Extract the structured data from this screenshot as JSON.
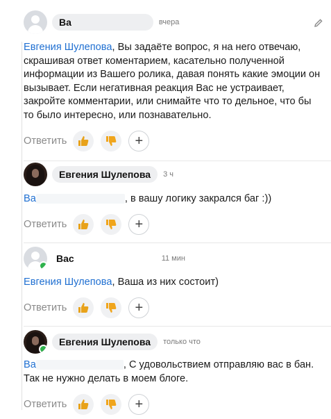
{
  "reply_label": "Ответить",
  "colors": {
    "mention": "#1f6fd1",
    "online": "#2fb24c",
    "like": "#e8a21a",
    "dislike": "#f0a51c"
  },
  "comments": [
    {
      "author": "Ва",
      "time": "вчера",
      "mention": "Евгения Шулепова",
      "text": ", Вы задаёте вопрос, я на него отвечаю, скрашивая ответ коментарием, касательно полученной информации из Вашего ролика, давая понять какие эмоции он вызывает. Если негативная реакция Вас не устраивает, закройте комментарии, или снимайте что то дельное, что бы то было интересно, или познавательно.",
      "avatar": "default-avatar-icon",
      "online": false
    },
    {
      "author": "Евгения Шулепова",
      "time": "3 ч",
      "mention": "Ва",
      "text": ", в вашу логику закрался баг :))",
      "avatar": "user-photo",
      "online": false
    },
    {
      "author": "Вас",
      "time": "11 мин",
      "mention": "Евгения Шулепова",
      "text": ", Ваша из них состоит)",
      "avatar": "default-avatar-icon",
      "online": true
    },
    {
      "author": "Евгения Шулепова",
      "time": "только что",
      "mention": "Ва",
      "text": ", С удовольствием отправляю вас в бан. Так не нужно делать в моем блоге.",
      "avatar": "user-photo",
      "online": true
    }
  ]
}
